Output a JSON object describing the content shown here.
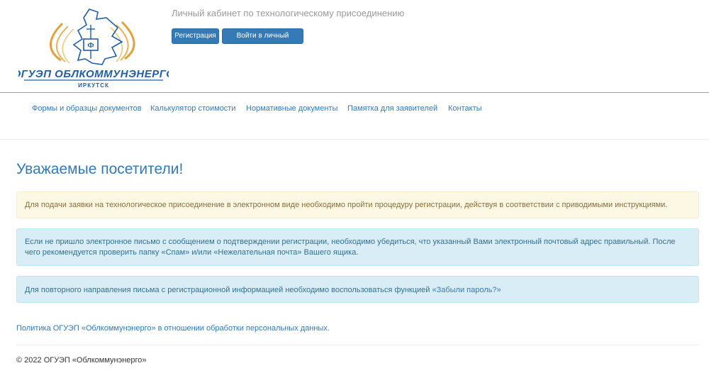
{
  "header": {
    "portal_title": "Личный кабинет по технологическому присоединению",
    "register_label": "Регистрация",
    "login_label": "Войти в личный кабинет",
    "logo": {
      "org_name": "ОГУЭП ОБЛКОММУНЭНЕРГО",
      "city": "ИРКУТСК",
      "brand_color": "#1f5fa8",
      "accent_color": "#e3a13a"
    }
  },
  "nav": {
    "items": [
      {
        "label": "Формы и образцы документов"
      },
      {
        "label": "Калькулятор стоимости"
      },
      {
        "label": "Нормативные документы"
      },
      {
        "label": "Памятка для заявителей"
      },
      {
        "label": "Контакты"
      }
    ]
  },
  "main": {
    "title": "Уважаемые посетители!",
    "alerts": [
      {
        "type": "warning",
        "text": "Для подачи заявки на технологическое присоединение в электронном виде необходимо пройти процедуру регистрации, действуя в соответствии с приводимыми инструкциями."
      },
      {
        "type": "info",
        "text": "Если не пришло электронное письмо с сообщением о подтверждении регистрации, необходимо убедиться, что указанный Вами электронный почтовый адрес правильный. После чего рекомендуется проверить папку «Спам» и/или «Нежелательная почта» Вашего ящика."
      },
      {
        "type": "info",
        "text": "Для повторного направления письма с регистрационной информацией необходимо воспользоваться функцией ",
        "link": "«Забыли пароль?»"
      }
    ],
    "policy_link": "Политика ОГУЭП «Облкоммунэнерго» в отношении обработки персональных данных."
  },
  "footer": {
    "copyright": "© 2022 ОГУЭП «Облкоммунэнерго»"
  },
  "colors": {
    "link": "#337ab7",
    "warning_bg": "#fcf8e3",
    "warning_text": "#8a6d3b",
    "info_bg": "#d9edf7",
    "info_text": "#31708f"
  }
}
